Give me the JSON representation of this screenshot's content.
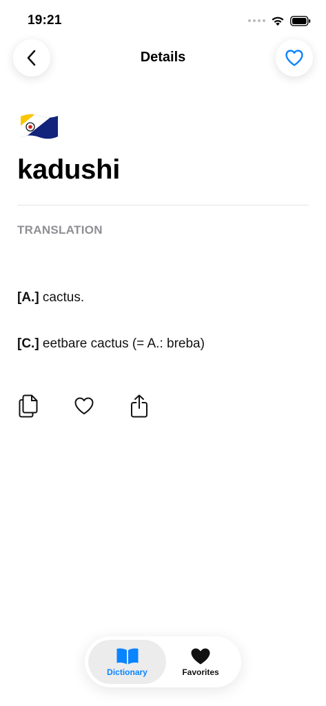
{
  "status_bar": {
    "time": "19:21"
  },
  "nav": {
    "title": "Details"
  },
  "entry": {
    "word": "kadushi",
    "section_label": "TRANSLATION",
    "translations": [
      {
        "code": "[A.]",
        "text": " cactus."
      },
      {
        "code": "[C.]",
        "text": " eetbare cactus (= A.: breba)"
      }
    ]
  },
  "tab_bar": {
    "tabs": [
      {
        "label": "Dictionary",
        "selected": true
      },
      {
        "label": "Favorites",
        "selected": false
      }
    ]
  },
  "colors": {
    "accent": "#0a84ff",
    "muted_label": "#8e8e93",
    "tab_selected_bg": "#ececec"
  },
  "icons": {
    "back": "chevron-left-icon",
    "favorite_nav": "heart-outline-icon",
    "flag": "bonaire-flag-icon",
    "copy": "copy-icon",
    "favorite_action": "heart-outline-icon",
    "share": "share-icon",
    "dictionary_tab": "book-icon",
    "favorites_tab": "heart-filled-icon"
  }
}
